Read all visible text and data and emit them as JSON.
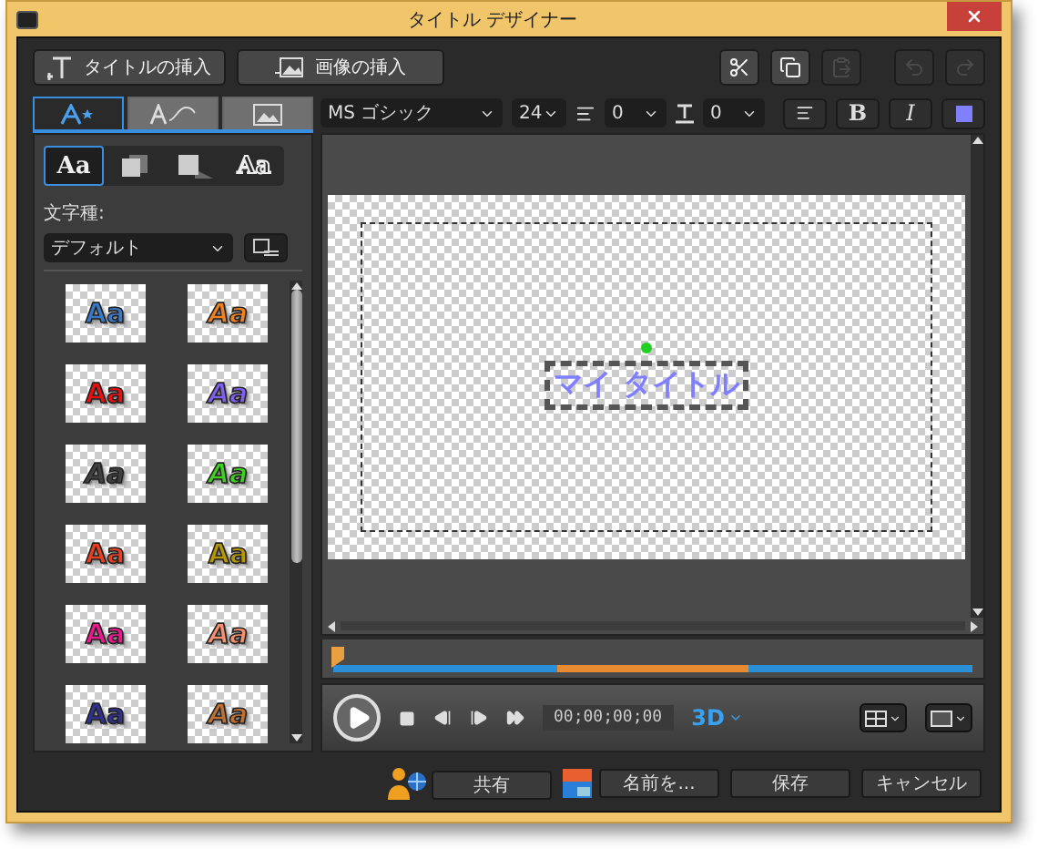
{
  "window": {
    "title": "タイトル デザイナー"
  },
  "toolbar": {
    "insert_buttons": [
      {
        "kind": "title",
        "label": "タイトルの挿入"
      },
      {
        "kind": "image",
        "label": "画像の挿入"
      }
    ],
    "edit_buttons": [
      {
        "kind": "cut",
        "disabled": false
      },
      {
        "kind": "copy",
        "disabled": false
      },
      {
        "kind": "paste",
        "disabled": true
      },
      {
        "kind": "undo",
        "disabled": true
      },
      {
        "kind": "redo",
        "disabled": true
      }
    ]
  },
  "left_panel": {
    "tabs": [
      {
        "kind": "style",
        "selected": true
      },
      {
        "kind": "motion",
        "selected": false
      },
      {
        "kind": "background",
        "selected": false
      }
    ],
    "modes": [
      {
        "kind": "text",
        "label": "Aa",
        "selected": true
      },
      {
        "kind": "shadow",
        "selected": false
      },
      {
        "kind": "light",
        "selected": false
      },
      {
        "kind": "outline",
        "label": "Aa",
        "selected": false
      }
    ],
    "type_label": "文字種:",
    "type_value": "デフォルト",
    "styles": [
      {
        "label": "Aa",
        "color": "#3a78c8",
        "italic": false
      },
      {
        "label": "Aa",
        "color": "#f08020",
        "italic": true
      },
      {
        "label": "Aa",
        "color": "#e81010",
        "italic": false
      },
      {
        "label": "Aa",
        "color": "#8060f0",
        "italic": true
      },
      {
        "label": "Aa",
        "color": "#404040",
        "italic": true
      },
      {
        "label": "Aa",
        "color": "#40d020",
        "italic": true
      },
      {
        "label": "Aa",
        "color": "#e84020",
        "italic": false
      },
      {
        "label": "Aa",
        "color": "#b89800",
        "italic": false
      },
      {
        "label": "Aa",
        "color": "#f01890",
        "italic": false
      },
      {
        "label": "Aa",
        "color": "#f89070",
        "italic": true
      },
      {
        "label": "Aa",
        "color": "#303090",
        "italic": false
      },
      {
        "label": "Aa",
        "color": "#c07030",
        "italic": true
      }
    ]
  },
  "format_bar": {
    "font": "MS ゴシック",
    "size": "24",
    "line_spacing": "0",
    "char_spacing": "0",
    "bold_label": "B",
    "italic_label": "I",
    "bold": false,
    "italic": false,
    "color": "#8080ff"
  },
  "canvas": {
    "title_text": "マイ タイトル"
  },
  "timeline": {
    "playhead": {
      "level": 0
    }
  },
  "playback": {
    "timecode": "00;00;00;00",
    "mode_label": "3D"
  },
  "footer": {
    "buttons": [
      {
        "kind": "share",
        "label": "共有"
      },
      {
        "kind": "saveas",
        "label": "名前を..."
      },
      {
        "kind": "plain",
        "label": "保存"
      },
      {
        "kind": "plain",
        "label": "キャンセル"
      }
    ]
  }
}
